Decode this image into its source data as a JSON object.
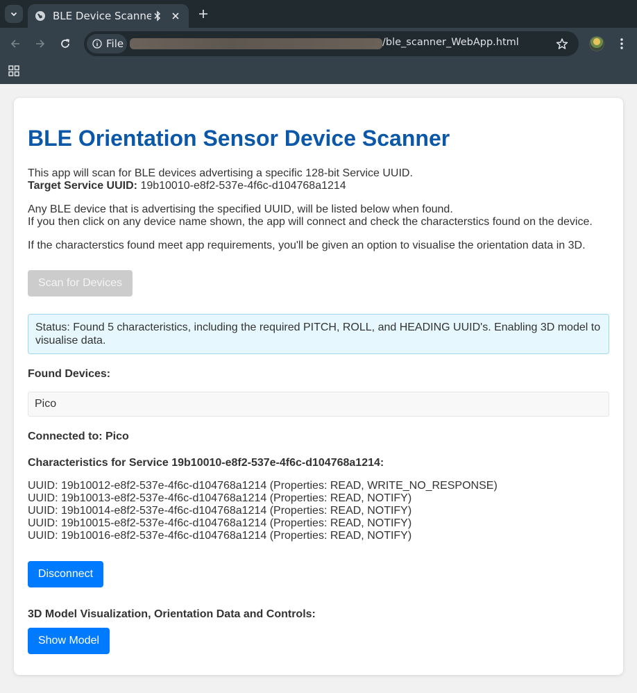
{
  "browser": {
    "tab_title": "BLE Device Scanner",
    "omnibox_chip": "File",
    "url_suffix": "/ble_scanner_WebApp.html"
  },
  "page": {
    "title": "BLE Orientation Sensor Device Scanner",
    "intro_line1": "This app will scan for BLE devices advertising a specific 128-bit Service UUID.",
    "target_label": "Target Service UUID:",
    "target_uuid": "19b10010-e8f2-537e-4f6c-d104768a1214",
    "info_line1": "Any BLE device that is advertising the specified UUID, will be listed below when found.",
    "info_line2": "If you then click on any device name shown, the app will connect and check the characterstics found on the device.",
    "info_line3": "If the characterstics found meet app requirements, you'll be given an option to visualise the orientation data in 3D.",
    "scan_button": "Scan for Devices",
    "status": "Status: Found 5 characteristics, including the required PITCH, ROLL, and HEADING UUID's. Enabling 3D model to visualise data.",
    "found_devices_heading": "Found Devices:",
    "devices": [
      "Pico"
    ],
    "connected_to": "Connected to: Pico",
    "characteristics_heading": "Characteristics for Service 19b10010-e8f2-537e-4f6c-d104768a1214:",
    "characteristics": [
      "UUID: 19b10012-e8f2-537e-4f6c-d104768a1214 (Properties: READ, WRITE_NO_RESPONSE)",
      "UUID: 19b10013-e8f2-537e-4f6c-d104768a1214 (Properties: READ, NOTIFY)",
      "UUID: 19b10014-e8f2-537e-4f6c-d104768a1214 (Properties: READ, NOTIFY)",
      "UUID: 19b10015-e8f2-537e-4f6c-d104768a1214 (Properties: READ, NOTIFY)",
      "UUID: 19b10016-e8f2-537e-4f6c-d104768a1214 (Properties: READ, NOTIFY)"
    ],
    "disconnect_button": "Disconnect",
    "visualization_heading": "3D Model Visualization, Orientation Data and Controls:",
    "show_model_button": "Show Model"
  },
  "colors": {
    "title": "#0b57a8",
    "primary_button": "#007bff",
    "disabled_button": "#cccccc",
    "status_background": "#e6f7fd",
    "status_border": "#9fd8ee"
  },
  "icons": [
    "tab-search-icon",
    "globe-icon",
    "bluetooth-icon",
    "close-icon",
    "plus-icon",
    "back-arrow-icon",
    "forward-arrow-icon",
    "reload-icon",
    "info-icon",
    "star-icon",
    "profile-avatar",
    "more-vert-icon",
    "apps-grid-icon"
  ]
}
